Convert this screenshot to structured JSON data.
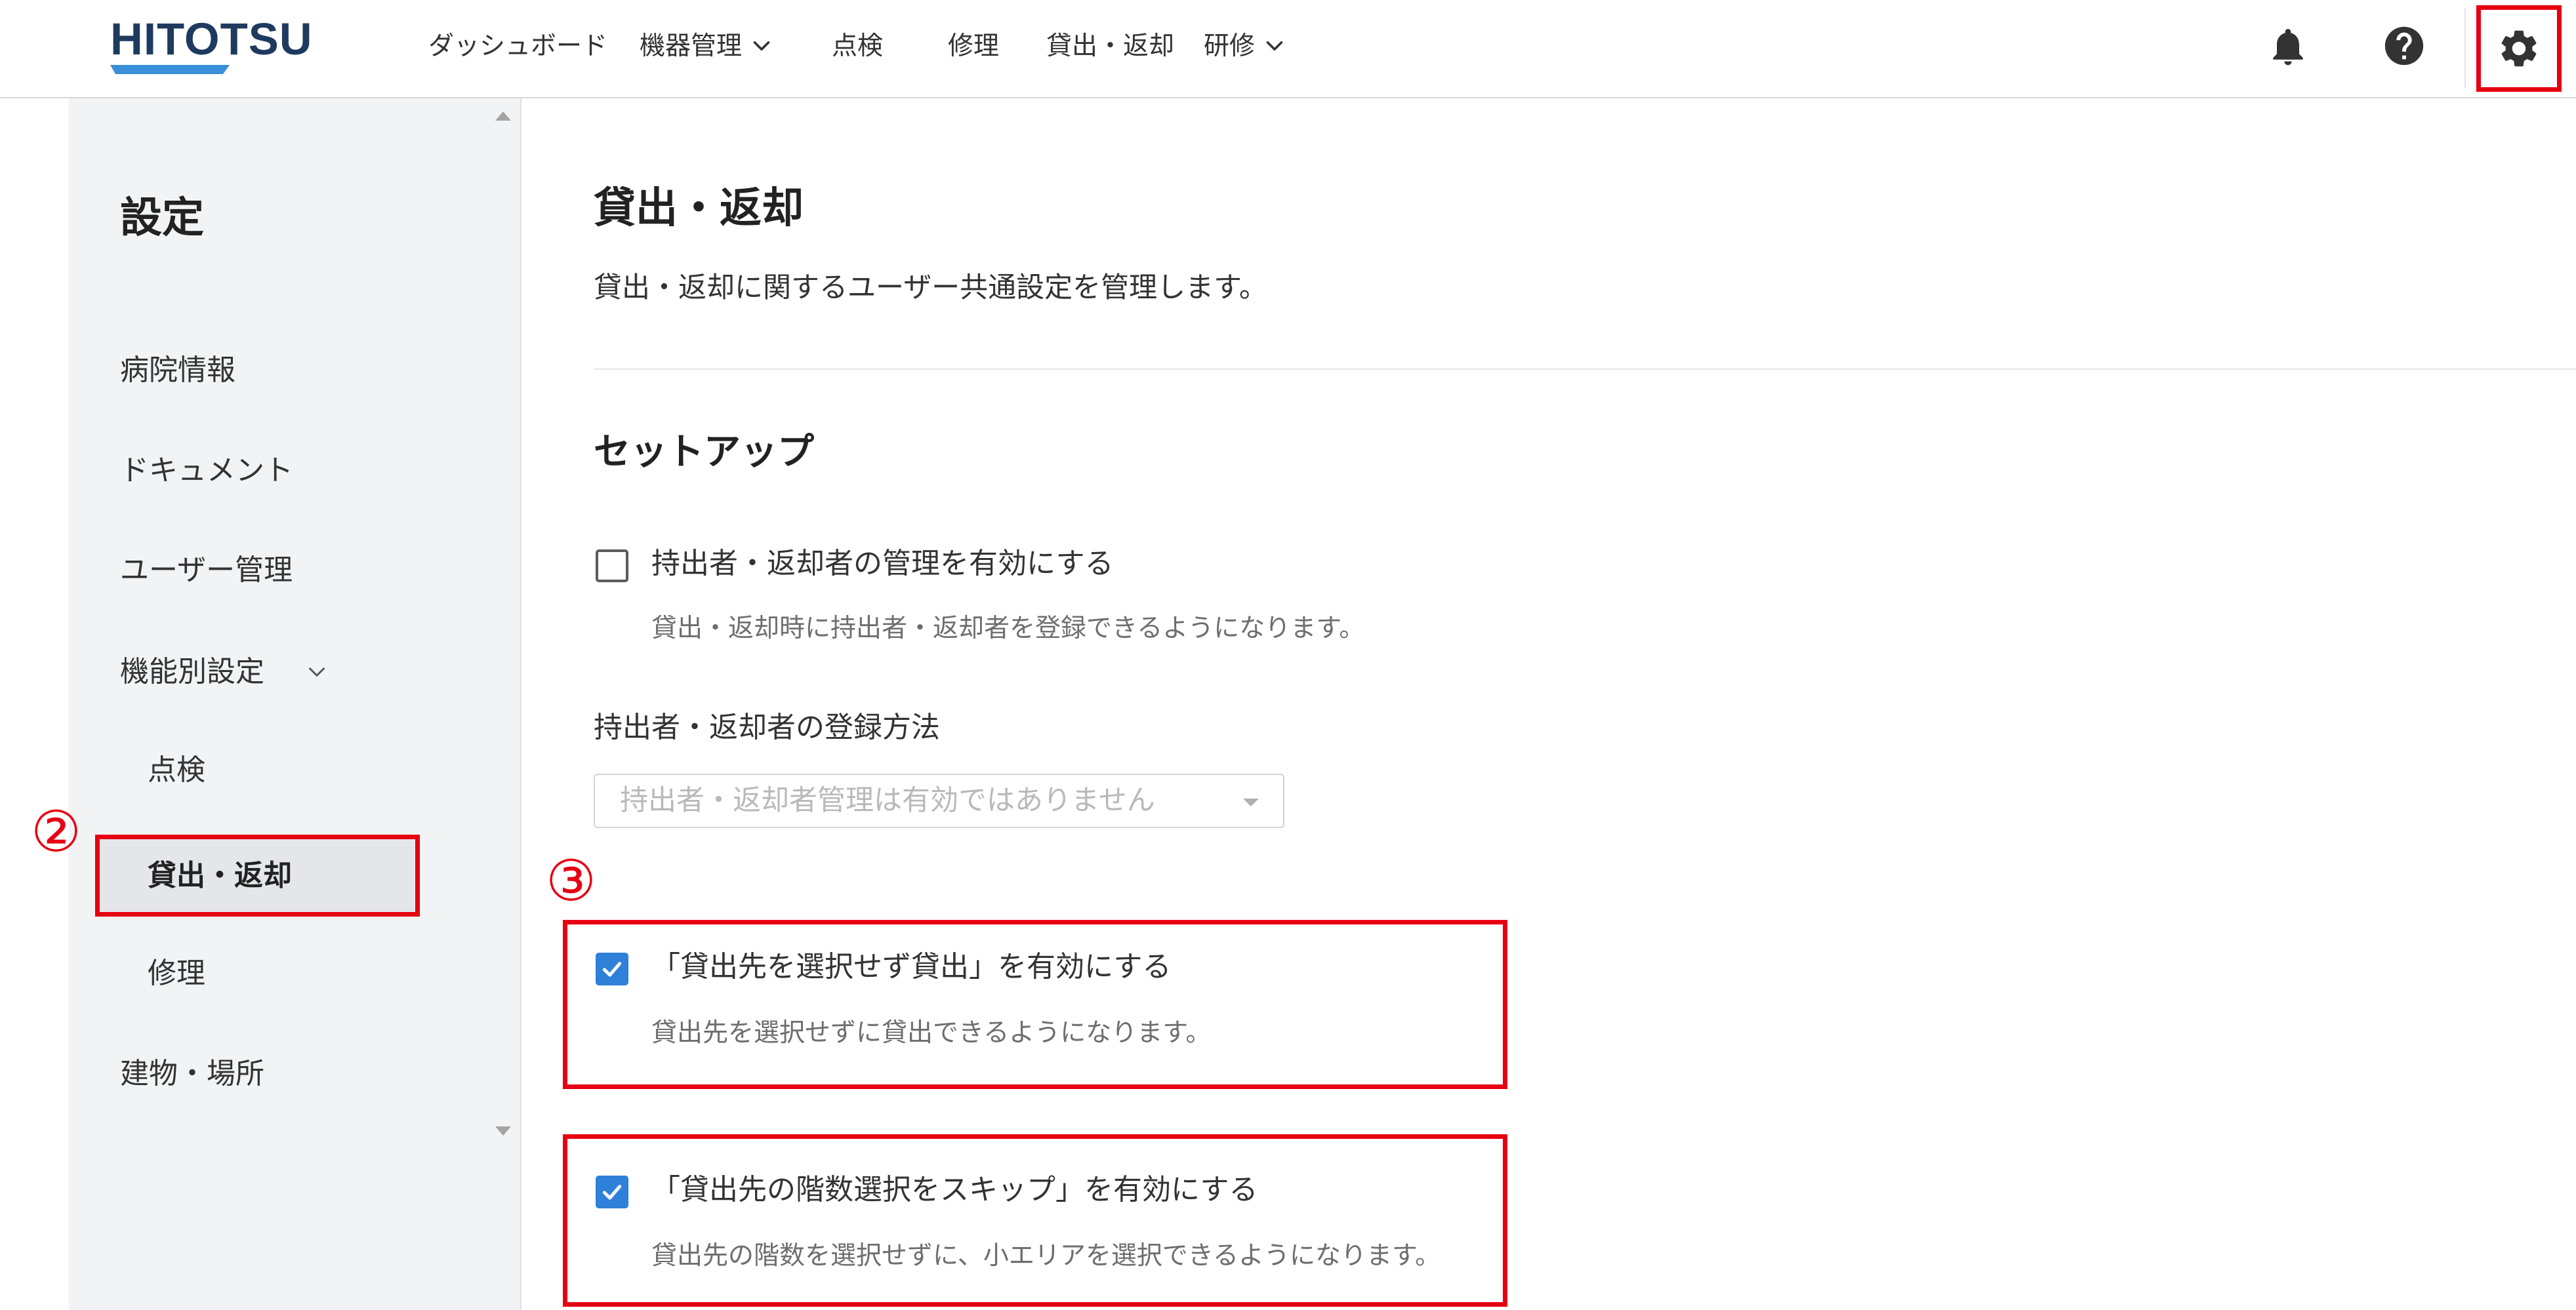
{
  "app": {
    "logo_text": "HITOTSU"
  },
  "header": {
    "nav": [
      {
        "label": "ダッシュボード"
      },
      {
        "label": "機器管理",
        "icon": "chevron-down-icon"
      },
      {
        "label": "点検"
      },
      {
        "label": "修理"
      },
      {
        "label": "貸出・返却"
      },
      {
        "label": "研修",
        "icon": "chevron-down-icon"
      }
    ],
    "actions": [
      {
        "icon": "bell-icon"
      },
      {
        "icon": "help-circle-icon"
      },
      {
        "icon": "gear-icon"
      }
    ]
  },
  "sidebar": {
    "title": "設定",
    "items": [
      {
        "label": "病院情報"
      },
      {
        "label": "ドキュメント"
      },
      {
        "label": "ユーザー管理"
      },
      {
        "label": "機能別設定",
        "icon": "chevron-down-icon",
        "expanded": true,
        "children": [
          {
            "label": "点検",
            "selected": false
          },
          {
            "label": "貸出・返却",
            "selected": true
          },
          {
            "label": "修理",
            "selected": false
          }
        ]
      },
      {
        "label": "建物・場所"
      }
    ],
    "scroll_up_icon": "triangle-up-icon",
    "scroll_down_icon": "triangle-down-icon"
  },
  "main": {
    "title": "貸出・返却",
    "description": "貸出・返却に関するユーザー共通設定を管理します。",
    "setup": {
      "title": "セットアップ",
      "manage_borrower": {
        "label": "持出者・返却者の管理を有効にする",
        "help": "貸出・返却時に持出者・返却者を登録できるようになります。",
        "checked": false
      },
      "register_method": {
        "label": "持出者・返却者の登録方法",
        "placeholder": "持出者・返却者管理は有効ではありません",
        "disabled": true
      },
      "lend_without_destination": {
        "label": "「貸出先を選択せず貸出」を有効にする",
        "help": "貸出先を選択せずに貸出できるようになります。",
        "checked": true
      },
      "skip_floor_selection": {
        "label": "「貸出先の階数選択をスキップ」を有効にする",
        "help": "貸出先の階数を選択せずに、小エリアを選択できるようになります。",
        "checked": true
      }
    }
  },
  "annotations": {
    "step2_marker": "②",
    "step3_marker": "③"
  },
  "colors": {
    "brand_navy": "#1f3a5f",
    "brand_blue": "#3a8fd9",
    "checkbox_checked": "#2f80d8",
    "annotation_red": "#e60012",
    "sidebar_bg": "#f2f3f5"
  }
}
